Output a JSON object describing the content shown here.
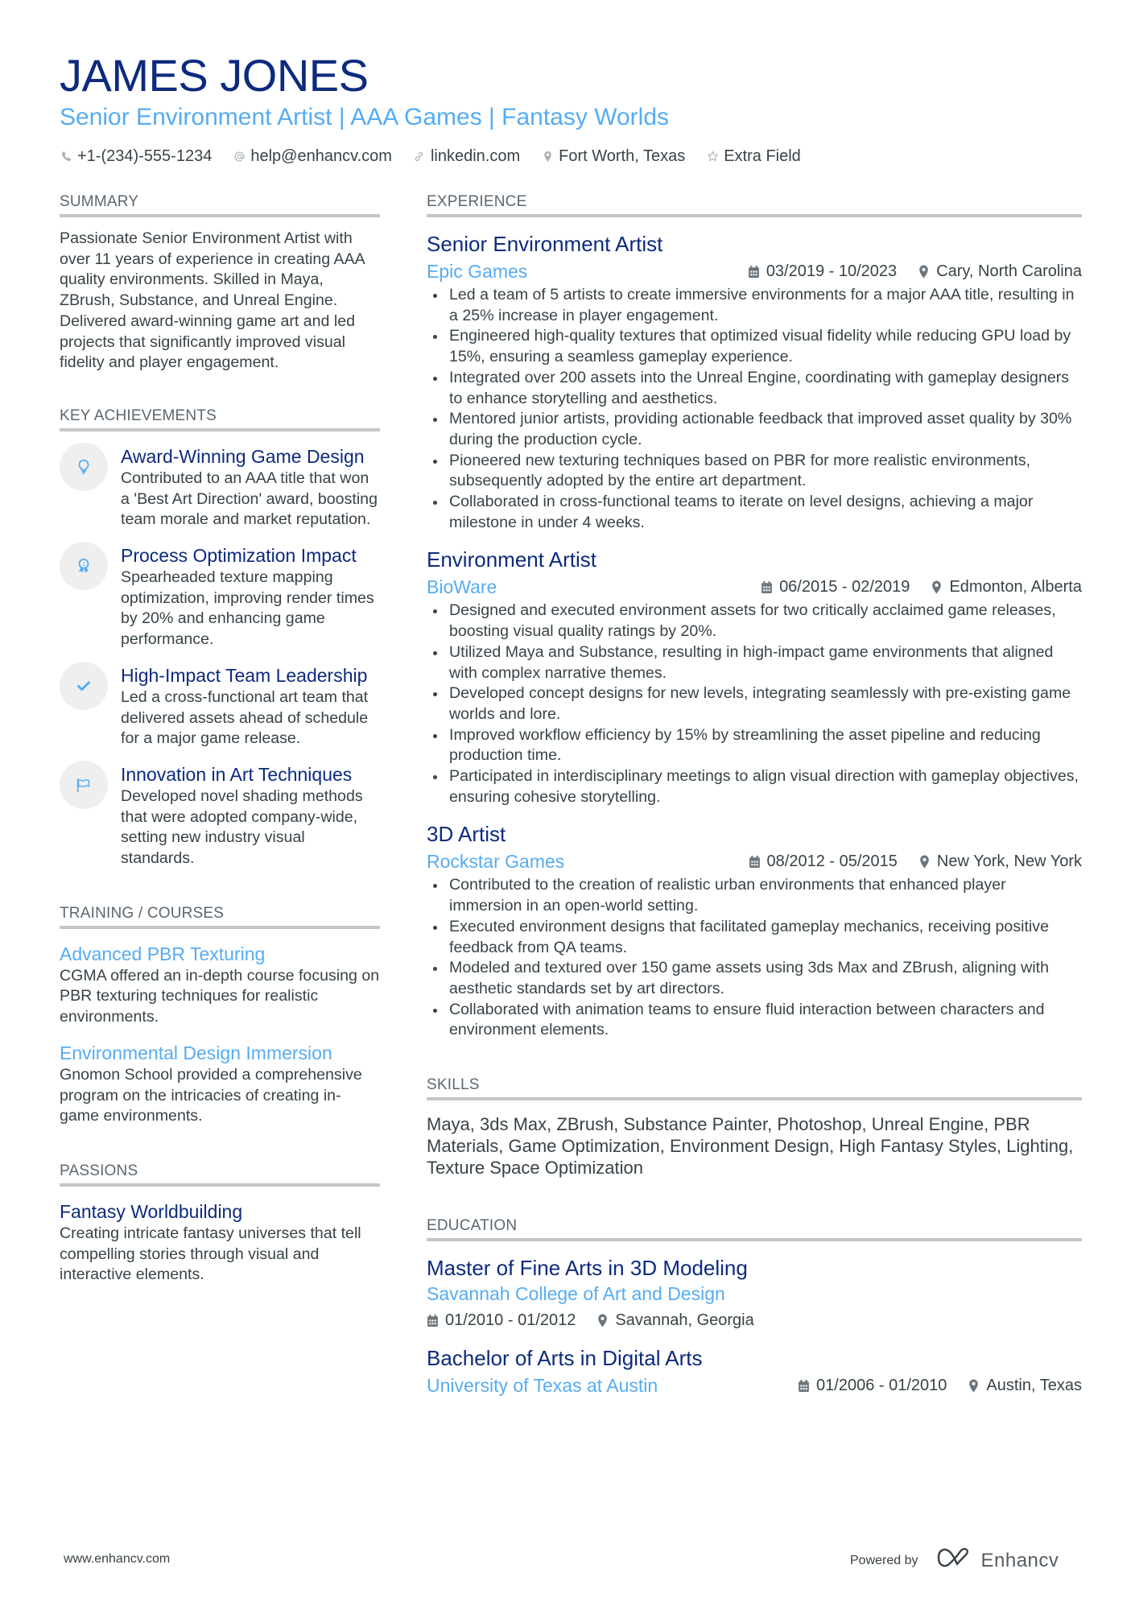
{
  "header": {
    "name": "JAMES JONES",
    "tagline": "Senior Environment Artist | AAA Games | Fantasy Worlds",
    "contacts": [
      {
        "icon": "phone-icon",
        "text": "+1-(234)-555-1234"
      },
      {
        "icon": "at-icon",
        "text": "help@enhancv.com"
      },
      {
        "icon": "link-icon",
        "text": "linkedin.com"
      },
      {
        "icon": "location-pin-icon",
        "text": "Fort Worth, Texas"
      },
      {
        "icon": "star-icon",
        "text": "Extra Field"
      }
    ]
  },
  "colors": {
    "navy": "#0d2a7e",
    "accent": "#56acf2",
    "text": "#384347",
    "rule": "#c2c6ca"
  },
  "summary": {
    "title": "SUMMARY",
    "text": "Passionate Senior Environment Artist with over 11 years of experience in creating AAA quality environments. Skilled in Maya, ZBrush, Substance, and Unreal Engine. Delivered award-winning game art and led projects that significantly improved visual fidelity and player engagement."
  },
  "achievements": {
    "title": "KEY ACHIEVEMENTS",
    "items": [
      {
        "icon": "lightbulb-icon",
        "title": "Award-Winning Game Design",
        "desc": "Contributed to an AAA title that won a 'Best Art Direction' award, boosting team morale and market reputation."
      },
      {
        "icon": "award-ribbon-icon",
        "title": "Process Optimization Impact",
        "desc": "Spearheaded texture mapping optimization, improving render times by 20% and enhancing game performance."
      },
      {
        "icon": "checkmark-icon",
        "title": "High-Impact Team Leadership",
        "desc": "Led a cross-functional art team that delivered assets ahead of schedule for a major game release."
      },
      {
        "icon": "flag-icon",
        "title": "Innovation in Art Techniques",
        "desc": "Developed novel shading methods that were adopted company-wide, setting new industry visual standards."
      }
    ]
  },
  "training": {
    "title": "TRAINING / COURSES",
    "items": [
      {
        "title": "Advanced PBR Texturing",
        "desc": "CGMA offered an in-depth course focusing on PBR texturing techniques for realistic environments."
      },
      {
        "title": "Environmental Design Immersion",
        "desc": "Gnomon School provided a comprehensive program on the intricacies of creating in-game environments."
      }
    ]
  },
  "passions": {
    "title": "PASSIONS",
    "items": [
      {
        "title": "Fantasy Worldbuilding",
        "desc": "Creating intricate fantasy universes that tell compelling stories through visual and interactive elements."
      }
    ]
  },
  "experience": {
    "title": "EXPERIENCE",
    "jobs": [
      {
        "title": "Senior Environment Artist",
        "company": "Epic Games",
        "dates": "03/2019 - 10/2023",
        "location": "Cary, North Carolina",
        "bullets": [
          "Led a team of 5 artists to create immersive environments for a major AAA title, resulting in a 25% increase in player engagement.",
          "Engineered high-quality textures that optimized visual fidelity while reducing GPU load by 15%, ensuring a seamless gameplay experience.",
          "Integrated over 200 assets into the Unreal Engine, coordinating with gameplay designers to enhance storytelling and aesthetics.",
          "Mentored junior artists, providing actionable feedback that improved asset quality by 30% during the production cycle.",
          "Pioneered new texturing techniques based on PBR for more realistic environments, subsequently adopted by the entire art department.",
          "Collaborated in cross-functional teams to iterate on level designs, achieving a major milestone in under 4 weeks."
        ]
      },
      {
        "title": "Environment Artist",
        "company": "BioWare",
        "dates": "06/2015 - 02/2019",
        "location": "Edmonton, Alberta",
        "bullets": [
          "Designed and executed environment assets for two critically acclaimed game releases, boosting visual quality ratings by 20%.",
          "Utilized Maya and Substance, resulting in high-impact game environments that aligned with complex narrative themes.",
          "Developed concept designs for new levels, integrating seamlessly with pre-existing game worlds and lore.",
          "Improved workflow efficiency by 15% by streamlining the asset pipeline and reducing production time.",
          "Participated in interdisciplinary meetings to align visual direction with gameplay objectives, ensuring cohesive storytelling."
        ]
      },
      {
        "title": "3D Artist",
        "company": "Rockstar Games",
        "dates": "08/2012 - 05/2015",
        "location": "New York, New York",
        "bullets": [
          "Contributed to the creation of realistic urban environments that enhanced player immersion in an open-world setting.",
          "Executed environment designs that facilitated gameplay mechanics, receiving positive feedback from QA teams.",
          "Modeled and textured over 150 game assets using 3ds Max and ZBrush, aligning with aesthetic standards set by art directors.",
          "Collaborated with animation teams to ensure fluid interaction between characters and environment elements."
        ]
      }
    ]
  },
  "skills": {
    "title": "SKILLS",
    "text": "Maya, 3ds Max, ZBrush, Substance Painter, Photoshop, Unreal Engine, PBR Materials, Game Optimization, Environment Design, High Fantasy Styles, Lighting, Texture Space Optimization"
  },
  "education": {
    "title": "EDUCATION",
    "items": [
      {
        "degree": "Master of Fine Arts in 3D Modeling",
        "school": "Savannah College of Art and Design",
        "dates": "01/2010 - 01/2012",
        "location": "Savannah, Georgia"
      },
      {
        "degree": "Bachelor of Arts in Digital Arts",
        "school": "University of Texas at Austin",
        "dates": "01/2006 - 01/2010",
        "location": "Austin, Texas"
      }
    ]
  },
  "footer": {
    "website": "www.enhancv.com",
    "powered_by": "Powered by",
    "brand": "Enhancv"
  }
}
